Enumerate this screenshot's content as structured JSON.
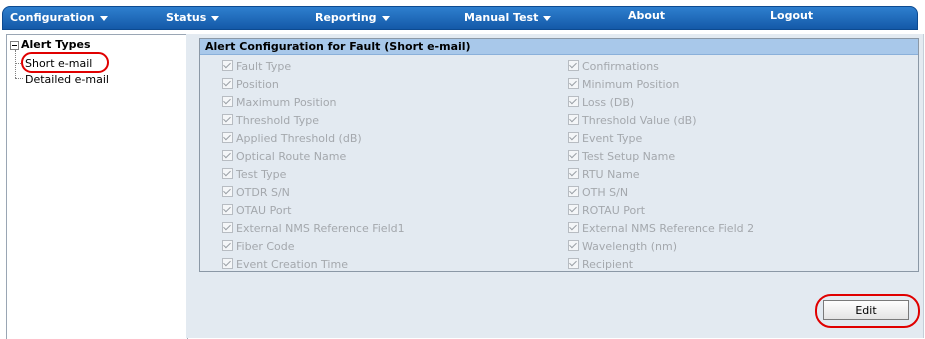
{
  "nav": {
    "items": [
      {
        "label": "Configuration",
        "dropdown": true
      },
      {
        "label": "Status",
        "dropdown": true
      },
      {
        "label": "Reporting",
        "dropdown": true
      },
      {
        "label": "Manual Test",
        "dropdown": true
      },
      {
        "label": "About",
        "dropdown": false
      },
      {
        "label": "Logout",
        "dropdown": false
      }
    ]
  },
  "tree": {
    "root_label": "Alert Types",
    "items": [
      {
        "label": "Short e-mail",
        "highlighted": true
      },
      {
        "label": "Detailed e-mail",
        "highlighted": false
      }
    ]
  },
  "panel": {
    "title": "Alert Configuration for Fault (Short e-mail)",
    "left_fields": [
      {
        "label": "Fault Type",
        "checked": true
      },
      {
        "label": "Position",
        "checked": true
      },
      {
        "label": "Maximum Position",
        "checked": true
      },
      {
        "label": "Threshold Type",
        "checked": true
      },
      {
        "label": "Applied Threshold (dB)",
        "checked": true
      },
      {
        "label": "Optical Route Name",
        "checked": true
      },
      {
        "label": "Test Type",
        "checked": true
      },
      {
        "label": "OTDR S/N",
        "checked": true
      },
      {
        "label": "OTAU Port",
        "checked": true
      },
      {
        "label": "External NMS Reference Field1",
        "checked": true
      },
      {
        "label": "Fiber Code",
        "checked": true
      },
      {
        "label": "Event Creation Time",
        "checked": true
      }
    ],
    "right_fields": [
      {
        "label": "Confirmations",
        "checked": true
      },
      {
        "label": "Minimum Position",
        "checked": true
      },
      {
        "label": "Loss (DB)",
        "checked": true
      },
      {
        "label": "Threshold Value (dB)",
        "checked": true
      },
      {
        "label": "Event Type",
        "checked": true
      },
      {
        "label": "Test Setup Name",
        "checked": true
      },
      {
        "label": "RTU Name",
        "checked": true
      },
      {
        "label": "OTH S/N",
        "checked": true
      },
      {
        "label": "ROTAU Port",
        "checked": true
      },
      {
        "label": "External NMS Reference Field 2",
        "checked": true
      },
      {
        "label": "Wavelength (nm)",
        "checked": true
      },
      {
        "label": "Recipient",
        "checked": true
      }
    ]
  },
  "edit_button_label": "Edit",
  "colors": {
    "nav_bg": "#1f6cbf",
    "panel_header": "#a8c8ea",
    "main_bg": "#e3eaf1",
    "highlight_circle": "#e00000",
    "disabled_text": "#a4a8ad"
  }
}
